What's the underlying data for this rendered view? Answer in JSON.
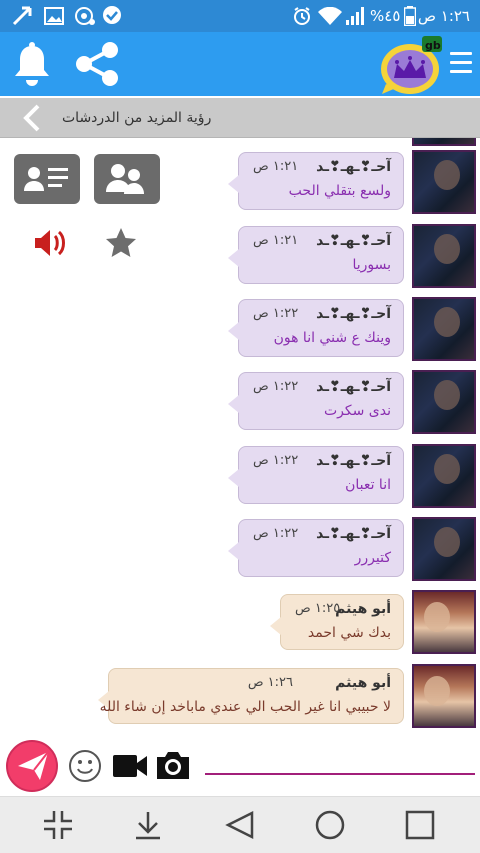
{
  "status_bar": {
    "time": "١:٢٦ ص",
    "battery": "%٤٥"
  },
  "header": {
    "logo_text": "gb"
  },
  "more_bar": {
    "label": "رؤية المزيد من الدردشات"
  },
  "messages": [
    {
      "sender": "آحـ❣ـهـ❣ـد",
      "time": "١:٢١ ص",
      "text": "ولسع بتقلي الحب",
      "style": "purple"
    },
    {
      "sender": "آحـ❣ـهـ❣ـد",
      "time": "١:٢١ ص",
      "text": "بسوريا",
      "style": "purple"
    },
    {
      "sender": "آحـ❣ـهـ❣ـد",
      "time": "١:٢٢ ص",
      "text": "وينك ع شني انا هون",
      "style": "purple"
    },
    {
      "sender": "آحـ❣ـهـ❣ـد",
      "time": "١:٢٢ ص",
      "text": "ندى سكرت",
      "style": "purple"
    },
    {
      "sender": "آحـ❣ـهـ❣ـد",
      "time": "١:٢٢ ص",
      "text": "انا تعبان",
      "style": "purple"
    },
    {
      "sender": "آحـ❣ـهـ❣ـد",
      "time": "١:٢٢ ص",
      "text": "كتيررر",
      "style": "purple"
    },
    {
      "sender": "أبو هيثم",
      "time": "١:٢٥ ص",
      "text": "بدك شي احمد",
      "style": "beige"
    },
    {
      "sender": "أبو هيثم",
      "time": "١:٢٦ ص",
      "text": "لا حبيبي انا غير الحب الي عندي ماباخد إن شاء الله",
      "style": "beige"
    }
  ],
  "colors": {
    "status_bar": "#2d89d4",
    "app_bar": "#2d9cf0",
    "purple_bubble": "#e5dbf1",
    "beige_bubble": "#f6e6d3",
    "send_button": "#f23d6a",
    "input_underline": "#a21f7a"
  },
  "icons": {
    "side_buttons": [
      "group-contact-icon",
      "contact-card-icon"
    ],
    "side_actions": [
      "star-icon",
      "speaker-icon"
    ],
    "input": [
      "send-icon",
      "emoji-icon",
      "video-camera-icon",
      "photo-camera-icon"
    ],
    "nav": [
      "collapse-icon",
      "download-icon",
      "back-icon",
      "home-icon",
      "recents-icon"
    ]
  }
}
